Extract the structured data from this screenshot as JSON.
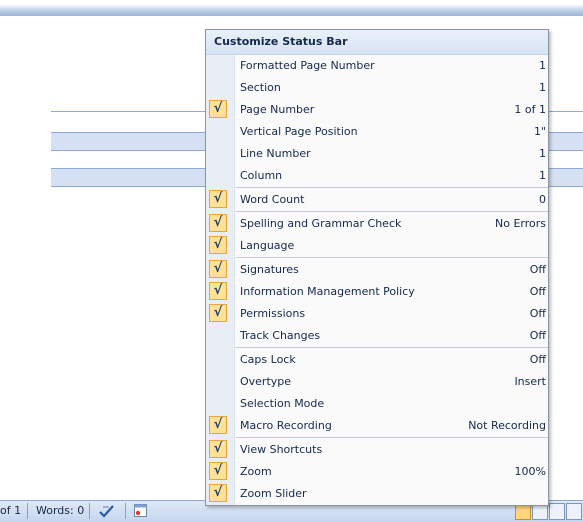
{
  "menu": {
    "title": "Customize Status Bar",
    "items": [
      {
        "label": "Formatted Page Number",
        "value": "1",
        "checked": false
      },
      {
        "label": "Section",
        "value": "1",
        "checked": false
      },
      {
        "label": "Page Number",
        "value": "1 of 1",
        "checked": true
      },
      {
        "label": "Vertical Page Position",
        "value": "1\"",
        "checked": false
      },
      {
        "label": "Line Number",
        "value": "1",
        "checked": false
      },
      {
        "label": "Column",
        "value": "1",
        "checked": false
      },
      {
        "label": "Word Count",
        "value": "0",
        "checked": true
      },
      {
        "label": "Spelling and Grammar Check",
        "value": "No Errors",
        "checked": true
      },
      {
        "label": "Language",
        "value": "",
        "checked": true
      },
      {
        "label": "Signatures",
        "value": "Off",
        "checked": true
      },
      {
        "label": "Information Management Policy",
        "value": "Off",
        "checked": true
      },
      {
        "label": "Permissions",
        "value": "Off",
        "checked": true
      },
      {
        "label": "Track Changes",
        "value": "Off",
        "checked": false
      },
      {
        "label": "Caps Lock",
        "value": "Off",
        "checked": false
      },
      {
        "label": "Overtype",
        "value": "Insert",
        "checked": false
      },
      {
        "label": "Selection Mode",
        "value": "",
        "checked": false
      },
      {
        "label": "Macro Recording",
        "value": "Not Recording",
        "checked": true
      },
      {
        "label": "View Shortcuts",
        "value": "",
        "checked": true
      },
      {
        "label": "Zoom",
        "value": "100%",
        "checked": true
      },
      {
        "label": "Zoom Slider",
        "value": "",
        "checked": true
      }
    ]
  },
  "statusbar": {
    "page": "of 1",
    "words": "Words: 0"
  },
  "icons": {
    "check": "checkmark-icon",
    "proofing": "proofing-check-icon",
    "macro": "macro-record-icon"
  }
}
